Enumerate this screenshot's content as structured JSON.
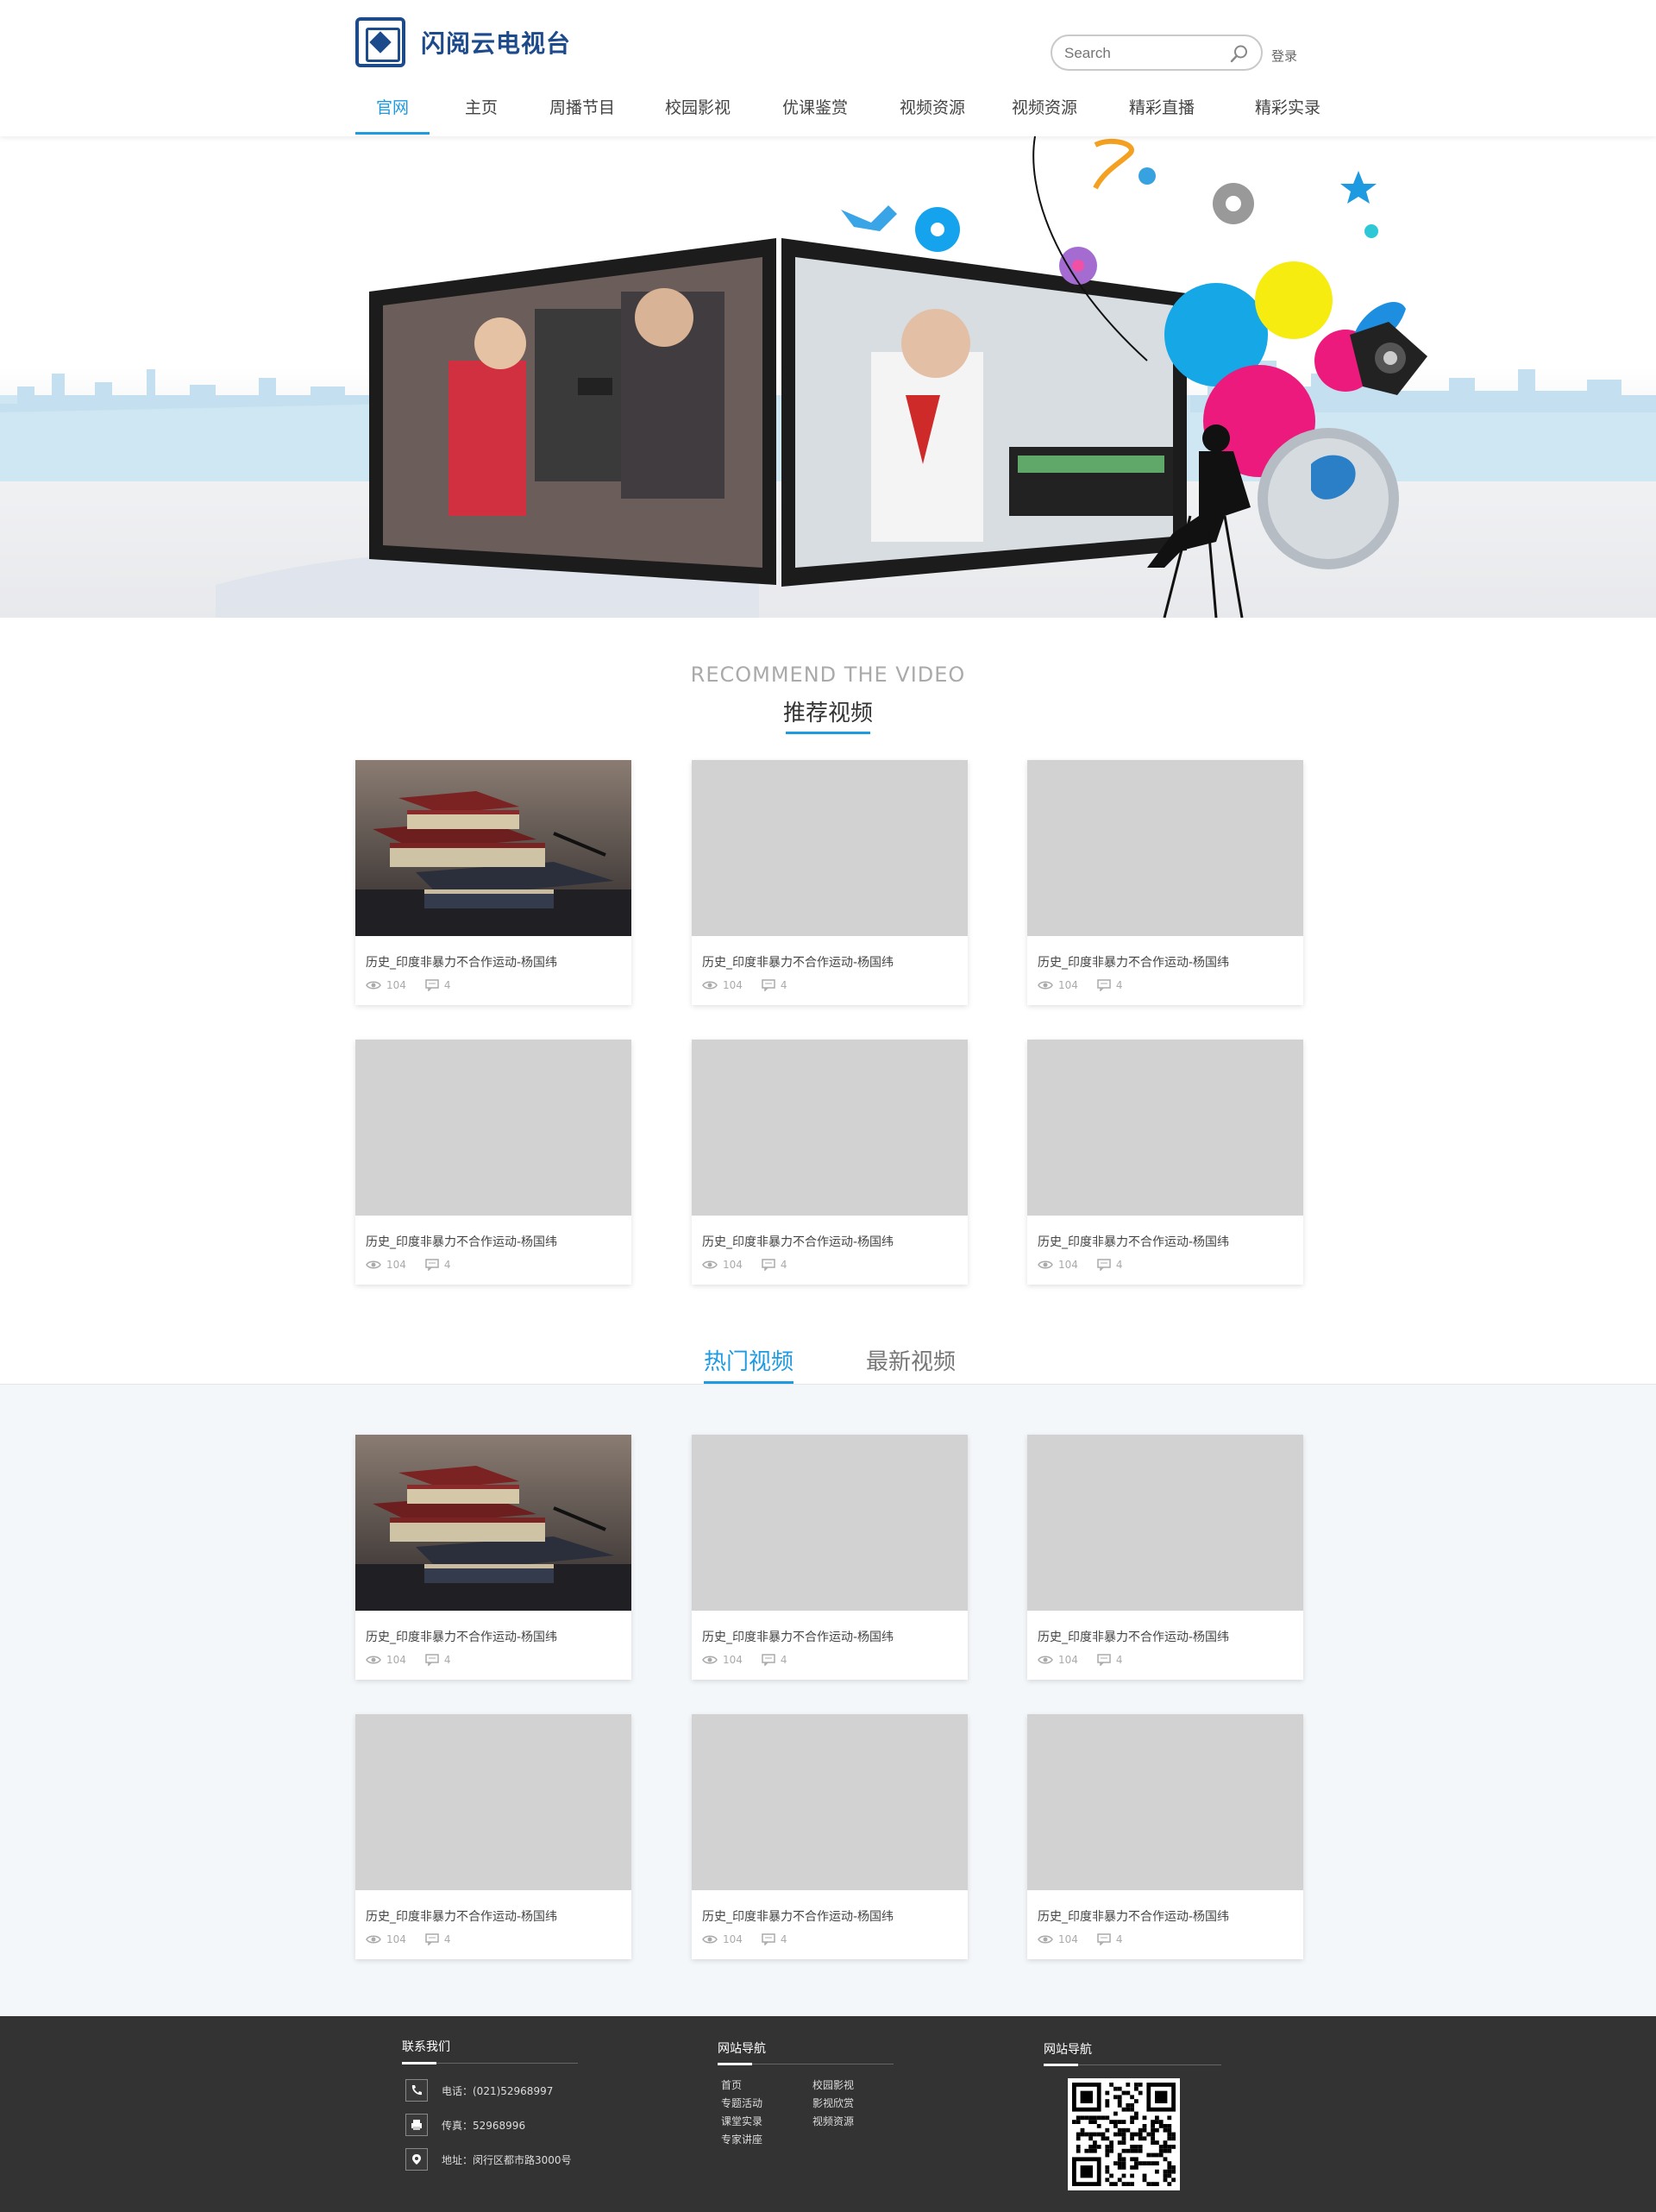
{
  "header": {
    "brand": "闪阅云电视台",
    "search_placeholder": "Search",
    "login": "登录"
  },
  "nav": [
    {
      "label": "官网",
      "active": true
    },
    {
      "label": "主页"
    },
    {
      "label": "周播节目"
    },
    {
      "label": "校园影视"
    },
    {
      "label": "优课鉴赏"
    },
    {
      "label": "视频资源"
    },
    {
      "label": "视频资源"
    },
    {
      "label": "精彩直播"
    },
    {
      "label": "精彩实录"
    }
  ],
  "recommend": {
    "en_title": "RECOMMEND THE VIDEO",
    "cn_title": "推荐视频",
    "cards": [
      {
        "title": "历史_印度非暴力不合作运动-杨国纬",
        "views": "104",
        "comments": "4",
        "thumb": "books"
      },
      {
        "title": "历史_印度非暴力不合作运动-杨国纬",
        "views": "104",
        "comments": "4",
        "thumb": "placeholder"
      },
      {
        "title": "历史_印度非暴力不合作运动-杨国纬",
        "views": "104",
        "comments": "4",
        "thumb": "placeholder"
      },
      {
        "title": "历史_印度非暴力不合作运动-杨国纬",
        "views": "104",
        "comments": "4",
        "thumb": "placeholder"
      },
      {
        "title": "历史_印度非暴力不合作运动-杨国纬",
        "views": "104",
        "comments": "4",
        "thumb": "placeholder"
      },
      {
        "title": "历史_印度非暴力不合作运动-杨国纬",
        "views": "104",
        "comments": "4",
        "thumb": "placeholder"
      }
    ]
  },
  "tabs": {
    "hot": "热门视频",
    "latest": "最新视频"
  },
  "hot": {
    "cards": [
      {
        "title": "历史_印度非暴力不合作运动-杨国纬",
        "views": "104",
        "comments": "4",
        "thumb": "books"
      },
      {
        "title": "历史_印度非暴力不合作运动-杨国纬",
        "views": "104",
        "comments": "4",
        "thumb": "placeholder"
      },
      {
        "title": "历史_印度非暴力不合作运动-杨国纬",
        "views": "104",
        "comments": "4",
        "thumb": "placeholder"
      },
      {
        "title": "历史_印度非暴力不合作运动-杨国纬",
        "views": "104",
        "comments": "4",
        "thumb": "placeholder"
      },
      {
        "title": "历史_印度非暴力不合作运动-杨国纬",
        "views": "104",
        "comments": "4",
        "thumb": "placeholder"
      },
      {
        "title": "历史_印度非暴力不合作运动-杨国纬",
        "views": "104",
        "comments": "4",
        "thumb": "placeholder"
      }
    ]
  },
  "footer": {
    "contact_title": "联系我们",
    "phone": "电话：(021)52968997",
    "fax": "传真：52968996",
    "address": "地址：闵行区都市路3000号",
    "nav_title": "网站导航",
    "nav_links_left": [
      "首页",
      "专题活动",
      "课堂实录",
      "专家讲座"
    ],
    "nav_links_right": [
      "校园影视",
      "影视欣赏",
      "视频资源"
    ],
    "qr_title": "网站导航"
  },
  "colors": {
    "accent": "#1e9be0",
    "brand": "#1d4a8a",
    "footer_bg": "#333333",
    "placeholder": "#d2d2d2"
  }
}
